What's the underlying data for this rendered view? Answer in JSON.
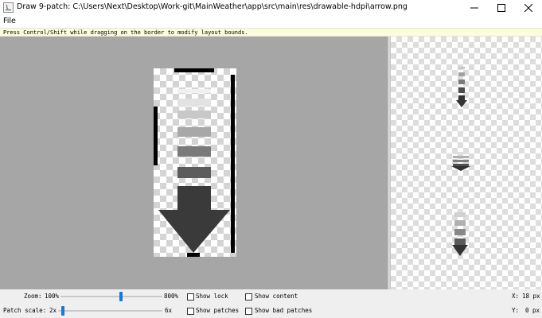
{
  "window": {
    "title": "Draw 9-patch: C:\\Users\\Next\\Desktop\\Work-git\\MainWeather\\app\\src\\main\\res\\drawable-hdpi\\arrow.png",
    "minimize_icon": "minimize-icon",
    "maximize_icon": "maximize-icon",
    "close_icon": "close-icon"
  },
  "menu": {
    "file": "File"
  },
  "hint": "Press Control/Shift while dragging on the border to modify layout bounds.",
  "controls": {
    "zoom": {
      "label": "Zoom:",
      "min": "100%",
      "max": "800%",
      "value_fraction": 0.6
    },
    "patch_scale": {
      "label": "Patch scale:",
      "min": "2x",
      "max": "6x",
      "value_fraction": 0.03
    },
    "checkboxes": [
      {
        "label": "Show lock",
        "checked": false
      },
      {
        "label": "Show content",
        "checked": false
      },
      {
        "label": "Show patches",
        "checked": false
      },
      {
        "label": "Show bad patches",
        "checked": false
      }
    ],
    "x_readout": {
      "label": "X:",
      "value": "18 px"
    },
    "y_readout": {
      "label": "Y:",
      "value": "0 px"
    }
  },
  "colors": {
    "editor_bg": "#a6a6a6",
    "slider_thumb": "#1878d2",
    "arrow": "#3a3a3a"
  }
}
